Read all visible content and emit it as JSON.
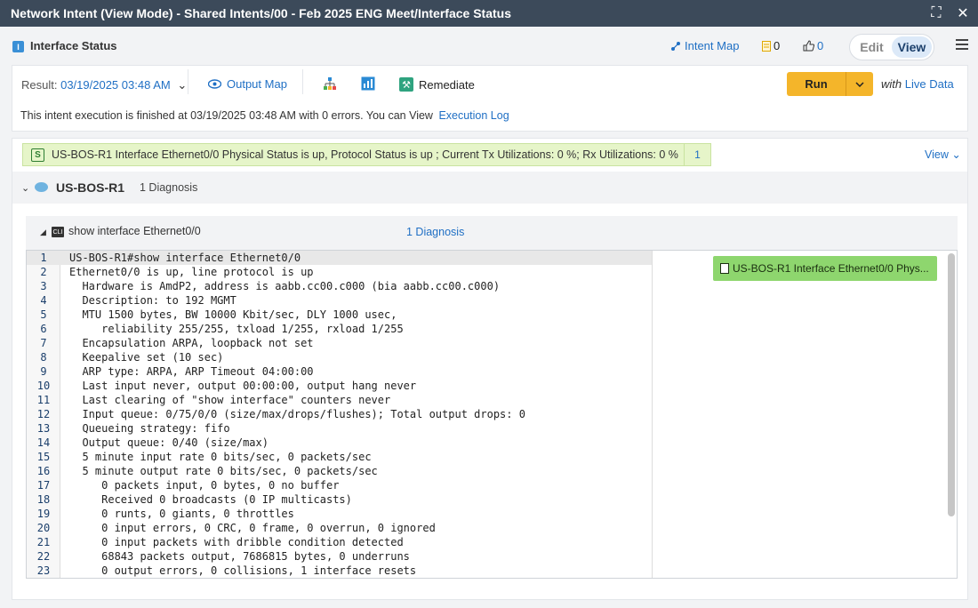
{
  "window": {
    "title": "Network Intent (View Mode) - Shared Intents/00 - Feb 2025 ENG Meet/Interface Status"
  },
  "header": {
    "icon_letter": "I",
    "title": "Interface Status",
    "intent_map_label": "Intent Map",
    "note_count": "0",
    "like_count": "0",
    "mode_edit": "Edit",
    "mode_view": "View",
    "mode_selected": "View"
  },
  "toolbar": {
    "result_label": "Result:",
    "result_value": "03/19/2025 03:48 AM",
    "output_map_label": "Output Map",
    "remediate_label": "Remediate",
    "run_label": "Run",
    "with_label": "with",
    "live_data_label": "Live Data"
  },
  "execution": {
    "message": "This intent execution is finished at 03/19/2025 03:48 AM with 0 errors. You can View",
    "log_link": "Execution Log"
  },
  "results": {
    "banner_badge": "S",
    "banner_text": "US-BOS-R1 Interface Ethernet0/0 Physical Status is up, Protocol Status is up ; Current Tx Utilizations: 0 %; Rx Utilizations: 0 %",
    "banner_count": "1",
    "view_label": "View"
  },
  "device": {
    "name": "US-BOS-R1",
    "diagnosis": "1 Diagnosis"
  },
  "command": {
    "cli_badge": "CLI",
    "name": "show interface Ethernet0/0",
    "diagnosis": "1 Diagnosis",
    "diag_chip": "US-BOS-R1 Interface Ethernet0/0 Phys...",
    "lines": [
      {
        "n": "1",
        "t": "US-BOS-R1#show interface Ethernet0/0"
      },
      {
        "n": "2",
        "t": "Ethernet0/0 is up, line protocol is up"
      },
      {
        "n": "3",
        "t": "  Hardware is AmdP2, address is aabb.cc00.c000 (bia aabb.cc00.c000)"
      },
      {
        "n": "4",
        "t": "  Description: to 192 MGMT"
      },
      {
        "n": "5",
        "t": "  MTU 1500 bytes, BW 10000 Kbit/sec, DLY 1000 usec,"
      },
      {
        "n": "6",
        "t": "     reliability 255/255, txload 1/255, rxload 1/255"
      },
      {
        "n": "7",
        "t": "  Encapsulation ARPA, loopback not set"
      },
      {
        "n": "8",
        "t": "  Keepalive set (10 sec)"
      },
      {
        "n": "9",
        "t": "  ARP type: ARPA, ARP Timeout 04:00:00"
      },
      {
        "n": "10",
        "t": "  Last input never, output 00:00:00, output hang never"
      },
      {
        "n": "11",
        "t": "  Last clearing of \"show interface\" counters never"
      },
      {
        "n": "12",
        "t": "  Input queue: 0/75/0/0 (size/max/drops/flushes); Total output drops: 0"
      },
      {
        "n": "13",
        "t": "  Queueing strategy: fifo"
      },
      {
        "n": "14",
        "t": "  Output queue: 0/40 (size/max)"
      },
      {
        "n": "15",
        "t": "  5 minute input rate 0 bits/sec, 0 packets/sec"
      },
      {
        "n": "16",
        "t": "  5 minute output rate 0 bits/sec, 0 packets/sec"
      },
      {
        "n": "17",
        "t": "     0 packets input, 0 bytes, 0 no buffer"
      },
      {
        "n": "18",
        "t": "     Received 0 broadcasts (0 IP multicasts)"
      },
      {
        "n": "19",
        "t": "     0 runts, 0 giants, 0 throttles"
      },
      {
        "n": "20",
        "t": "     0 input errors, 0 CRC, 0 frame, 0 overrun, 0 ignored"
      },
      {
        "n": "21",
        "t": "     0 input packets with dribble condition detected"
      },
      {
        "n": "22",
        "t": "     68843 packets output, 7686815 bytes, 0 underruns"
      },
      {
        "n": "23",
        "t": "     0 output errors, 0 collisions, 1 interface resets"
      }
    ]
  },
  "colors": {
    "titlebar": "#3c4a5a",
    "link": "#1f6fc4",
    "run_button": "#f4b52a",
    "banner_bg": "#e6f5c9",
    "diag_chip": "#8ed66e"
  }
}
